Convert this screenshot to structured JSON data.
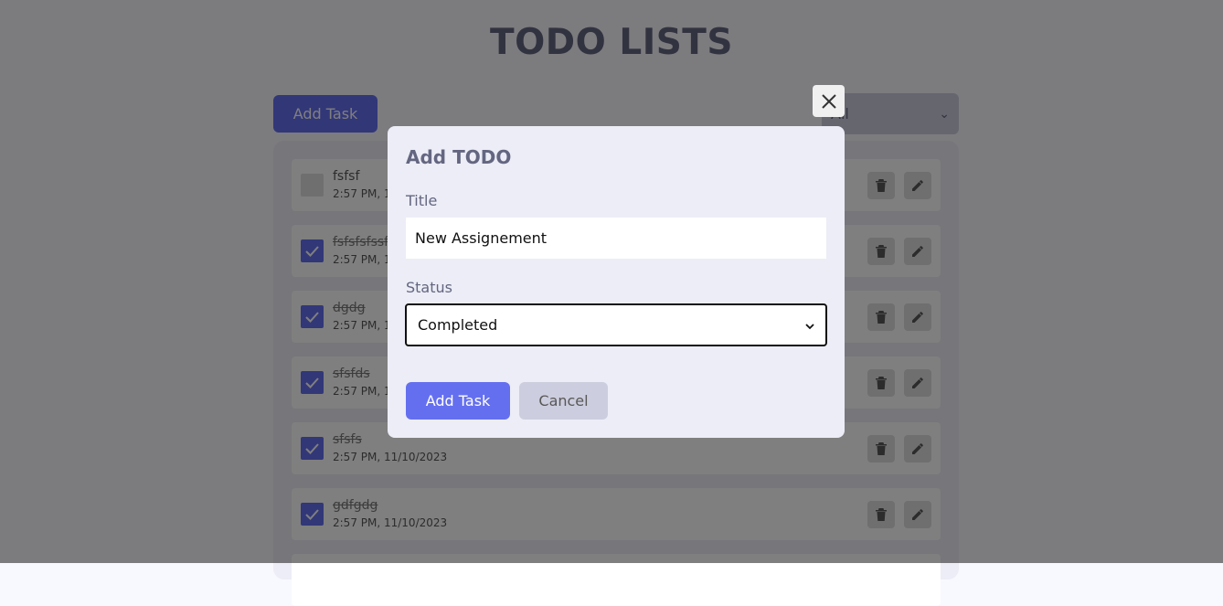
{
  "header": {
    "title": "TODO LISTS"
  },
  "toolbar": {
    "add_task_label": "Add Task",
    "filter_value": "All"
  },
  "todos": [
    {
      "title": "fsfsf",
      "time": "2:57 PM, 11/10/2023",
      "completed": false
    },
    {
      "title": "fsfsfsfssf",
      "time": "2:57 PM, 11/10/2023",
      "completed": true
    },
    {
      "title": "dgdg",
      "time": "2:57 PM, 11/10/2023",
      "completed": true
    },
    {
      "title": "sfsfds",
      "time": "2:57 PM, 11/10/2023",
      "completed": true
    },
    {
      "title": "sfsfs",
      "time": "2:57 PM, 11/10/2023",
      "completed": true
    },
    {
      "title": "gdfgdg",
      "time": "2:57 PM, 11/10/2023",
      "completed": true
    }
  ],
  "modal": {
    "title": "Add TODO",
    "title_label": "Title",
    "title_value": "New Assignement",
    "status_label": "Status",
    "status_value": "Completed",
    "add_label": "Add Task",
    "cancel_label": "Cancel"
  },
  "colors": {
    "accent": "#646ff0",
    "overlay": "rgba(0,0,0,0.5)"
  },
  "icons": {
    "close": "close-icon",
    "delete": "trash-icon",
    "edit": "pencil-icon",
    "check": "check-icon"
  }
}
